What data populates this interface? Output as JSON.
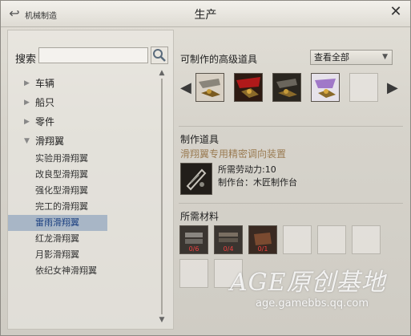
{
  "window": {
    "title": "生产",
    "breadcrumb": "机械制造"
  },
  "search": {
    "label": "搜索",
    "value": "",
    "placeholder": ""
  },
  "tree": {
    "categories": [
      {
        "label": "车辆",
        "expanded": false
      },
      {
        "label": "船只",
        "expanded": false
      },
      {
        "label": "零件",
        "expanded": false
      },
      {
        "label": "滑翔翼",
        "expanded": true
      }
    ],
    "subitems": [
      "实验用滑翔翼",
      "改良型滑翔翼",
      "强化型滑翔翼",
      "完工的滑翔翼",
      "雷雨滑翔翼",
      "红龙滑翔翼",
      "月影滑翔翼",
      "依纪女神滑翔翼"
    ],
    "selected_index": 4
  },
  "advanced": {
    "title": "可制作的高级道具",
    "filter_value": "查看全部"
  },
  "craft": {
    "title": "制作道具",
    "item_name": "滑翔翼专用精密调向装置",
    "labor_label": "所需劳动力:10",
    "bench_label": "制作台：木匠制作台"
  },
  "materials": {
    "title": "所需材料",
    "quantities": [
      "0/6",
      "0/4",
      "0/1"
    ]
  },
  "watermark": {
    "text": "AGE原创基地",
    "url": "age.gamebbs.qq.com"
  },
  "colors": {
    "accent_blue": "#1a3f80",
    "item_gold": "#9a7b52",
    "qty_red": "#f04040"
  }
}
